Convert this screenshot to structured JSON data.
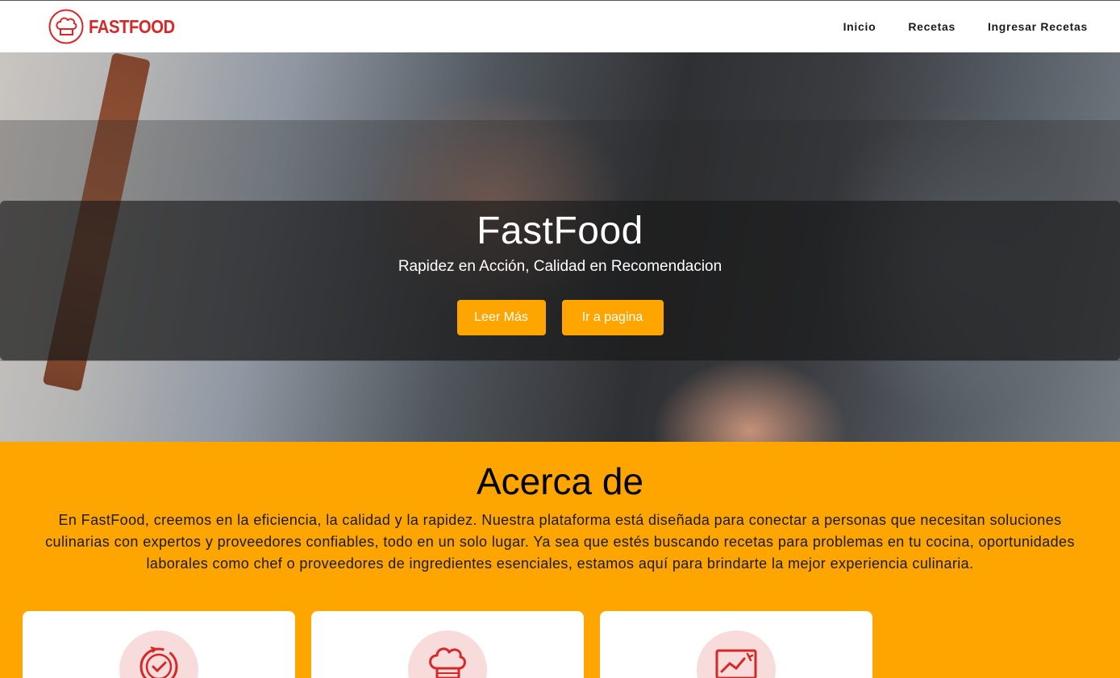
{
  "brand": {
    "name": "FASTFOOD",
    "color": "#d62828"
  },
  "nav": {
    "items": [
      {
        "label": "Inicio"
      },
      {
        "label": "Recetas"
      },
      {
        "label": "Ingresar Recetas"
      }
    ]
  },
  "hero": {
    "title": "FastFood",
    "subtitle": "Rapidez en Acción, Calidad en Recomendacion",
    "buttons": {
      "read_more": "Leer Más",
      "go_page": "Ir a pagina"
    }
  },
  "about": {
    "title": "Acerca de",
    "text": "En FastFood, creemos en la eficiencia, la calidad y la rapidez. Nuestra plataforma está diseñada para conectar a personas que necesitan soluciones culinarias con expertos y proveedores confiables, todo en un solo lugar. Ya sea que estés buscando recetas para problemas en tu cocina, oportunidades laborales como chef o proveedores de ingredientes esenciales, estamos aquí para brindarte la mejor experiencia culinaria."
  },
  "cards": [
    {
      "icon": "clock-check-icon"
    },
    {
      "icon": "chef-hat-icon"
    },
    {
      "icon": "chart-screen-icon"
    }
  ],
  "colors": {
    "accent": "#ffa500",
    "icon_red": "#d62828",
    "icon_bg": "#f8dcdc"
  }
}
